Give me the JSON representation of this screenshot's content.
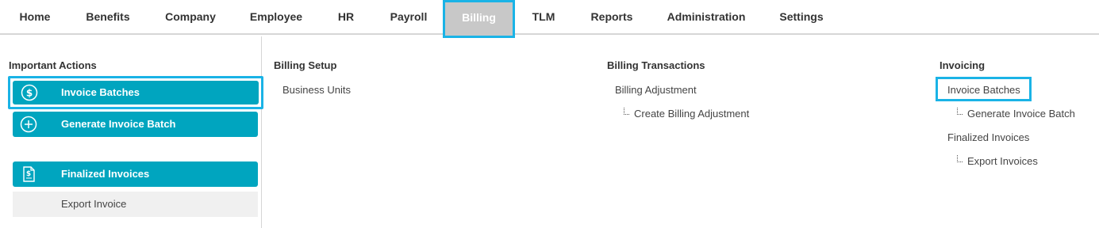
{
  "nav": {
    "tabs": [
      {
        "label": "Home"
      },
      {
        "label": "Benefits"
      },
      {
        "label": "Company"
      },
      {
        "label": "Employee"
      },
      {
        "label": "HR"
      },
      {
        "label": "Payroll"
      },
      {
        "label": "Billing",
        "active": true
      },
      {
        "label": "TLM"
      },
      {
        "label": "Reports"
      },
      {
        "label": "Administration"
      },
      {
        "label": "Settings"
      }
    ]
  },
  "important_actions": {
    "title": "Important Actions",
    "buttons": [
      {
        "label": "Invoice Batches",
        "icon": "dollar-circle-icon"
      },
      {
        "label": "Generate Invoice Batch",
        "icon": "plus-circle-icon"
      },
      {
        "label": "Finalized Invoices",
        "icon": "dollar-document-icon"
      },
      {
        "label": "Export Invoice"
      }
    ]
  },
  "billing_setup": {
    "title": "Billing Setup",
    "items": [
      {
        "label": "Business Units"
      }
    ]
  },
  "billing_transactions": {
    "title": "Billing Transactions",
    "items": [
      {
        "label": "Billing Adjustment"
      },
      {
        "label": "Create Billing Adjustment"
      }
    ]
  },
  "invoicing": {
    "title": "Invoicing",
    "items": [
      {
        "label": "Invoice Batches"
      },
      {
        "label": "Generate Invoice Batch"
      },
      {
        "label": "Finalized Invoices"
      },
      {
        "label": "Export Invoices"
      }
    ]
  },
  "colors": {
    "accent": "#00a5bf",
    "highlight_border": "#1ab3e6",
    "active_tab_bg": "#c8c8c8"
  }
}
